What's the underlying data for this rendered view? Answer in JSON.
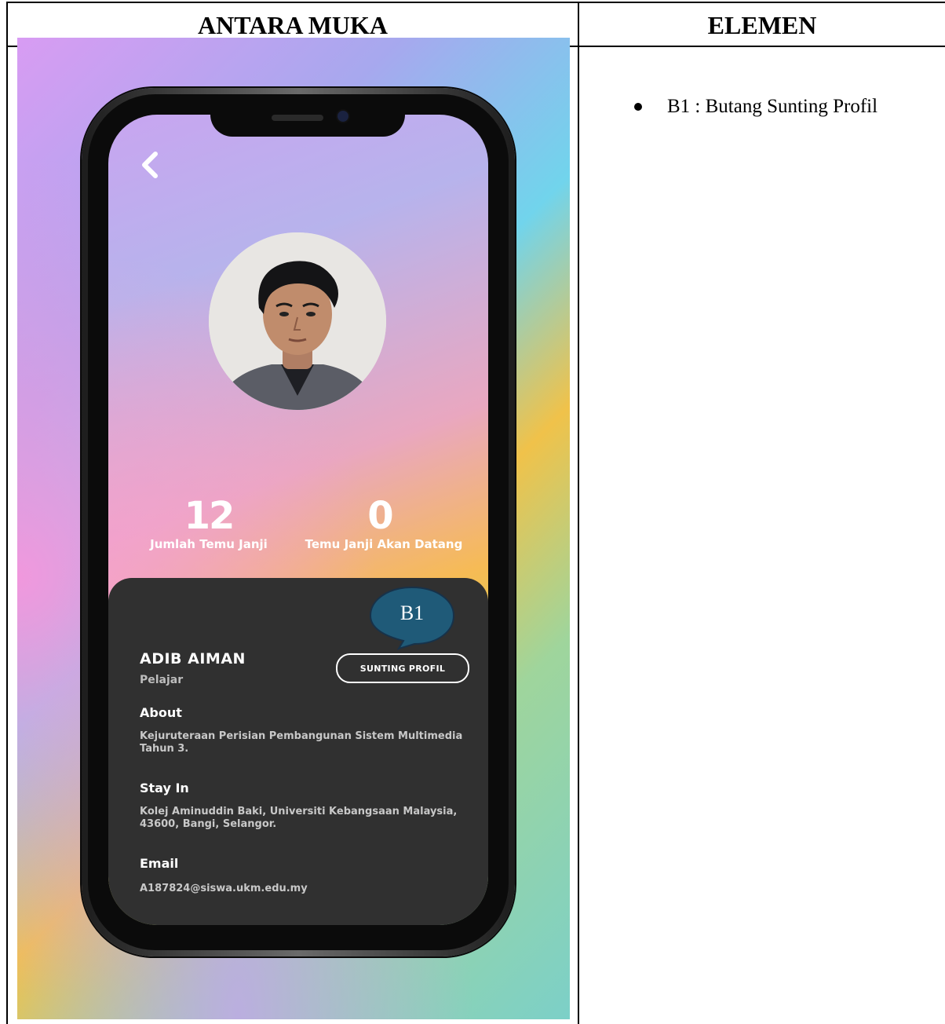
{
  "table": {
    "header_left": "ANTARA MUKA",
    "header_right": "ELEMEN"
  },
  "app": {
    "stats": [
      {
        "value": "12",
        "label": "Jumlah Temu Janji"
      },
      {
        "value": "0",
        "label": "Temu Janji Akan Datang"
      }
    ],
    "profile": {
      "name": "ADIB AIMAN",
      "role": "Pelajar",
      "edit_button": "SUNTING PROFIL",
      "about_title": "About",
      "about_text": "Kejuruteraan Perisian Pembangunan Sistem Multimedia Tahun 3.",
      "stay_title": "Stay In",
      "stay_text": "Kolej Aminuddin Baki, Universiti Kebangsaan Malaysia, 43600, Bangi, Selangor.",
      "email_title": "Email",
      "email_text": "A187824@siswa.ukm.edu.my"
    }
  },
  "callout": {
    "label": "B1",
    "color": "#1f5a78"
  },
  "elements": [
    {
      "text": "B1 : Butang Sunting Profil"
    }
  ],
  "icons": {
    "back": "chevron-left-icon",
    "avatar": "user-photo"
  }
}
